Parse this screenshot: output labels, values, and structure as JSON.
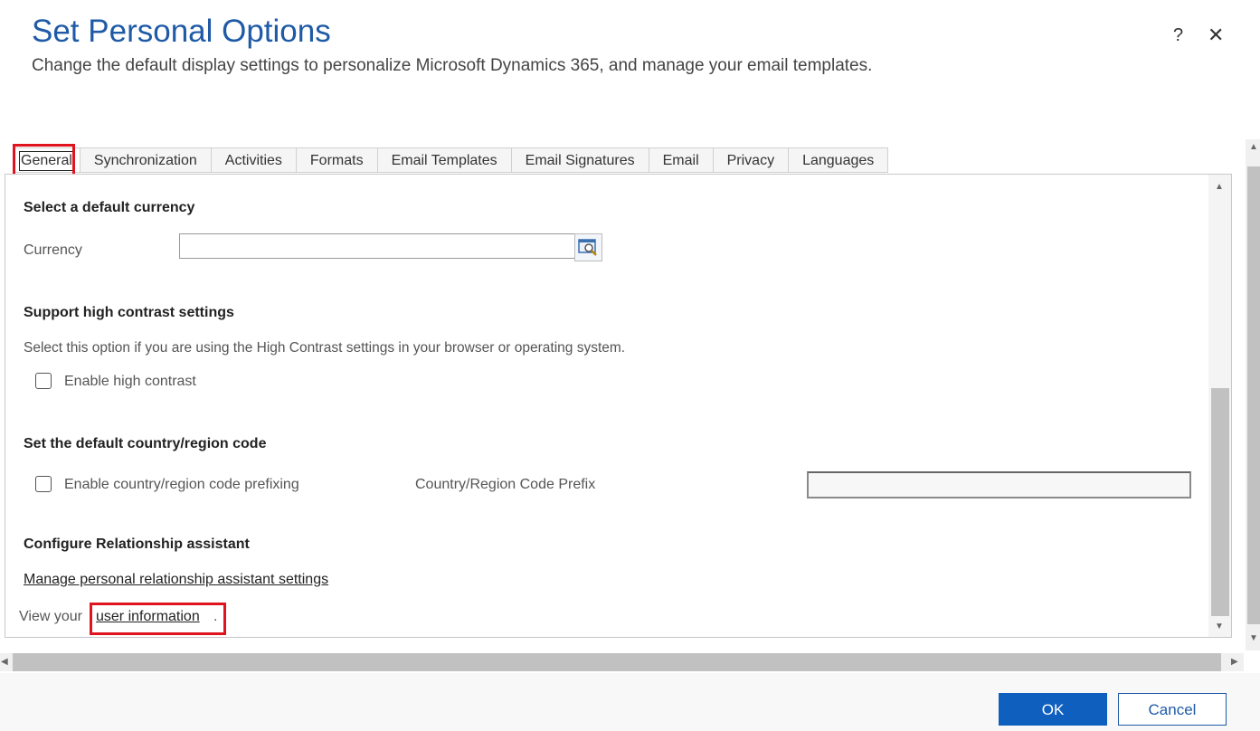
{
  "dialog": {
    "title": "Set Personal Options",
    "subtitle": "Change the default display settings to personalize Microsoft Dynamics 365, and manage your email templates.",
    "help_glyph": "?",
    "close_glyph": "✕"
  },
  "tabs": [
    {
      "label": "General",
      "active": true
    },
    {
      "label": "Synchronization"
    },
    {
      "label": "Activities"
    },
    {
      "label": "Formats"
    },
    {
      "label": "Email Templates"
    },
    {
      "label": "Email Signatures"
    },
    {
      "label": "Email"
    },
    {
      "label": "Privacy"
    },
    {
      "label": "Languages"
    }
  ],
  "general": {
    "currency_heading": "Select a default currency",
    "currency_label": "Currency",
    "currency_value": "",
    "contrast_heading": "Support high contrast settings",
    "contrast_desc": "Select this option if you are using the High Contrast settings in your browser or operating system.",
    "contrast_checkbox": "Enable high contrast",
    "contrast_checked": false,
    "country_heading": "Set the default country/region code",
    "country_checkbox": "Enable country/region code prefixing",
    "country_checked": false,
    "country_prefix_label": "Country/Region Code Prefix",
    "country_prefix_value": "",
    "ra_heading": "Configure Relationship assistant",
    "ra_link": "Manage personal relationship assistant settings",
    "view_prefix": "View your ",
    "user_info_link": "user information",
    "view_suffix": "."
  },
  "footer": {
    "ok_label": "OK",
    "cancel_label": "Cancel"
  },
  "colors": {
    "title": "#1f5aa6",
    "primary_button": "#0f5fbf",
    "highlight": "#e0141e"
  },
  "icons": {
    "help": "help-icon",
    "close": "close-icon",
    "lookup": "lookup-icon"
  }
}
